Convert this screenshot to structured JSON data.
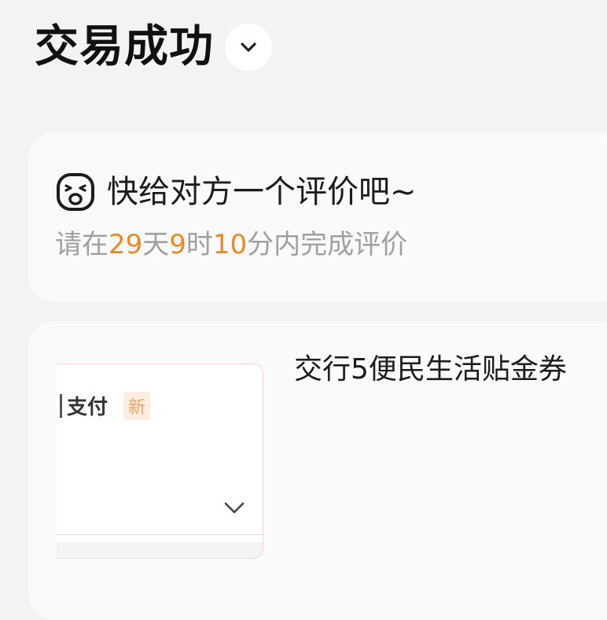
{
  "header": {
    "status": "交易成功",
    "expand_icon": "chevron-down-icon"
  },
  "review": {
    "icon": "face-icon",
    "title": "快给对方一个评价吧~",
    "deadline": {
      "prefix": "请在",
      "days": "29",
      "days_unit": "天",
      "hours": "9",
      "hours_unit": "时",
      "minutes": "10",
      "minutes_unit": "分",
      "suffix": "内完成评价"
    }
  },
  "item": {
    "title": "交行5便民生活贴金券",
    "thumbnail": {
      "label": "支付",
      "badge": "新",
      "chevron_icon": "chevron-down-icon"
    }
  },
  "colors": {
    "accent": "#f08a1c",
    "muted": "#a0a0a0",
    "background": "#f3f3f3",
    "card": "#fafafa"
  }
}
